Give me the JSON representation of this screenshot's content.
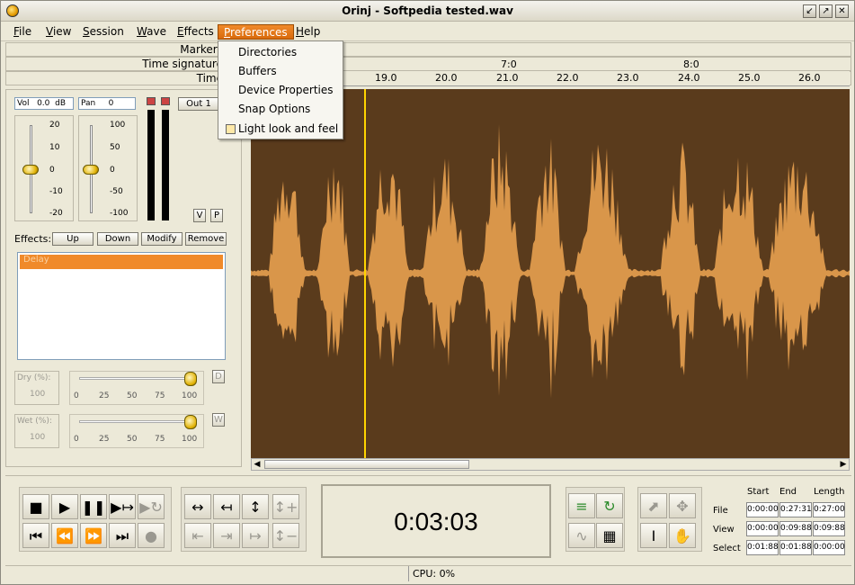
{
  "window": {
    "title": "Orinj - Softpedia tested.wav",
    "controls": [
      "minimize-icon",
      "maximize-icon",
      "close-icon"
    ]
  },
  "menu": {
    "items": [
      {
        "label": "File",
        "key": "F"
      },
      {
        "label": "View",
        "key": "V"
      },
      {
        "label": "Session",
        "key": "S"
      },
      {
        "label": "Wave",
        "key": "W"
      },
      {
        "label": "Effects",
        "key": "E"
      },
      {
        "label": "Preferences",
        "key": "P"
      },
      {
        "label": "Help",
        "key": "H"
      }
    ]
  },
  "preferences_menu": {
    "items": [
      "Directories",
      "Buffers",
      "Device Properties",
      "Snap Options",
      "Light look and feel"
    ]
  },
  "rulers": {
    "markers": "Markers",
    "time_signature": "Time signature",
    "time": "Time"
  },
  "time_ruler": {
    "bars": [
      "7:0",
      "8:0"
    ],
    "seconds": [
      "19.0",
      "20.0",
      "21.0",
      "22.0",
      "23.0",
      "24.0",
      "25.0",
      "26.0"
    ]
  },
  "track": {
    "vol_label": "Vol",
    "vol_value": "0.0",
    "vol_unit": "dB",
    "pan_label": "Pan",
    "pan_value": "0",
    "output": "Out 1",
    "vol_scale": [
      "20",
      "10",
      "0",
      "-10",
      "-20"
    ],
    "pan_scale": [
      "100",
      "50",
      "0",
      "-50",
      "-100"
    ],
    "v_button": "V",
    "p_button": "P"
  },
  "effects": {
    "label": "Effects:",
    "buttons": [
      "Up",
      "Down",
      "Modify",
      "Remove"
    ],
    "list": [
      "Delay"
    ]
  },
  "dry": {
    "label": "Dry (%):",
    "value": "100",
    "button": "D",
    "scale": [
      "0",
      "25",
      "50",
      "75",
      "100"
    ],
    "level": 100
  },
  "wet": {
    "label": "Wet (%):",
    "value": "100",
    "button": "W",
    "scale": [
      "0",
      "25",
      "50",
      "75",
      "100"
    ],
    "level": 100
  },
  "clock": {
    "time": "0:03:03"
  },
  "selection": {
    "headers": [
      "Start",
      "End",
      "Length"
    ],
    "rows": [
      {
        "label": "File",
        "start": "0:00:00",
        "end": "0:27:31",
        "length": "0:27:00"
      },
      {
        "label": "View",
        "start": "0:00:00",
        "end": "0:09:88",
        "length": "0:09:88"
      },
      {
        "label": "Select",
        "start": "0:01:88",
        "end": "0:01:88",
        "length": "0:00:00"
      }
    ]
  },
  "status": {
    "cpu": "CPU: 0%"
  },
  "colors": {
    "accent": "#f08a2a",
    "waveform": "#d9964a",
    "wave_background": "#5a3b1c",
    "cursor": "#ffd400"
  }
}
